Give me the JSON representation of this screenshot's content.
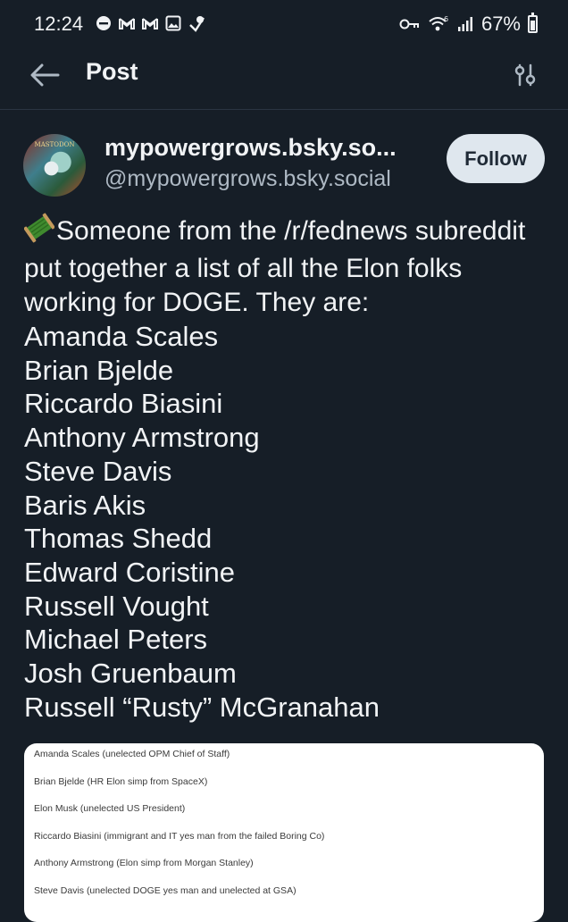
{
  "status_bar": {
    "time": "12:24",
    "battery": "67%",
    "battery_level": 0.67,
    "left_icons": [
      "minus-circle-icon",
      "gmail-icon",
      "gmail-icon",
      "image-icon",
      "check-shield-icon"
    ],
    "right_icons": [
      "key-icon",
      "wifi-6-icon",
      "signal-icon",
      "battery-icon"
    ]
  },
  "header": {
    "title": "Post",
    "back_icon": "arrow-left-icon",
    "filter_icon": "sliders-icon"
  },
  "author": {
    "display_name": "mypowergrows.bsky.so...",
    "handle": "@mypowergrows.bsky.social",
    "avatar_text": "MASTODON",
    "follow_label": "Follow"
  },
  "post": {
    "intro": "Someone from the /r/fednews subreddit put together a list of all the Elon folks working for DOGE. They are:",
    "names": [
      "Amanda Scales",
      "Brian Bjelde",
      "Riccardo Biasini",
      "Anthony Armstrong",
      "Steve Davis",
      "Baris Akis",
      "Thomas Shedd",
      "Edward Coristine",
      "Russell Vought",
      "Michael Peters",
      "Josh Gruenbaum",
      "Russell “Rusty” McGranahan"
    ]
  },
  "embed": {
    "rows": [
      "Amanda Scales (unelected OPM Chief of Staff)",
      "Brian Bjelde (HR Elon simp from SpaceX)",
      "Elon Musk (unelected US President)",
      "Riccardo Biasini (immigrant and IT yes man from the failed Boring Co)",
      "Anthony Armstrong (Elon simp from Morgan Stanley)",
      "Steve Davis (unelected DOGE yes man and unelected at GSA)"
    ]
  },
  "colors": {
    "background": "#161e27",
    "text": "#f1f3f5",
    "muted": "#aeb9c4",
    "follow_bg": "#dfe7ee"
  }
}
